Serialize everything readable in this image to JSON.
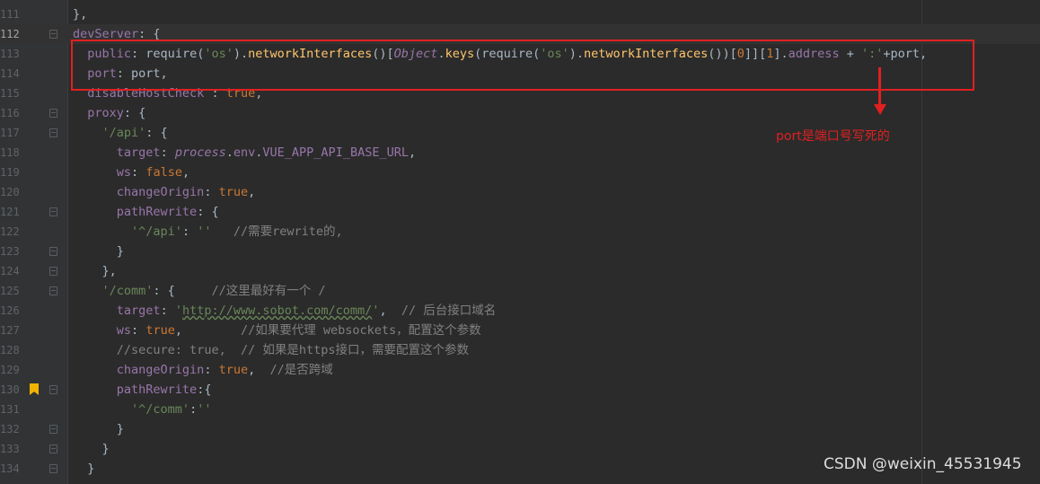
{
  "editor": {
    "lines": [
      {
        "num": "111",
        "html": "},"
      },
      {
        "num": "112",
        "html": "<span class=\"p\">devServer</span>: {"
      },
      {
        "num": "113",
        "html": "  <span class=\"p\">public</span>: require(<span class=\"s\">'os'</span>).<span class=\"f\">networkInterfaces</span>()[<span class=\"p i\">Object</span>.<span class=\"f\">keys</span>(require(<span class=\"s\">'os'</span>).<span class=\"f\">networkInterfaces</span>())[<span class=\"k\">0</span>]][<span class=\"k\">1</span>].<span class=\"p\">address</span> + <span class=\"s\">':'</span>+port,"
      },
      {
        "num": "114",
        "html": "  <span class=\"p\">port</span>: port,"
      },
      {
        "num": "115",
        "html": "  <span class=\"p\">disableHostCheck</span> : <span class=\"k\">true</span>,"
      },
      {
        "num": "116",
        "html": "  <span class=\"p\">proxy</span>: {"
      },
      {
        "num": "117",
        "html": "    <span class=\"s\">'/api'</span>: {"
      },
      {
        "num": "118",
        "html": "      <span class=\"p\">target</span>: <span class=\"p i\">process</span>.<span class=\"p\">env</span>.<span class=\"p\">VUE_APP_API_BASE_URL</span>,"
      },
      {
        "num": "119",
        "html": "      <span class=\"p\">ws</span>: <span class=\"k\">false</span>,"
      },
      {
        "num": "120",
        "html": "      <span class=\"p\">changeOrigin</span>: <span class=\"k\">true</span>,"
      },
      {
        "num": "121",
        "html": "      <span class=\"p\">pathRewrite</span>: {"
      },
      {
        "num": "122",
        "html": "        <span class=\"s\">'^/api'</span>: <span class=\"s\">''</span>   <span class=\"c\">//需要rewrite的,</span>"
      },
      {
        "num": "123",
        "html": "      }"
      },
      {
        "num": "124",
        "html": "    },"
      },
      {
        "num": "125",
        "html": "    <span class=\"s\">'/comm'</span>: {     <span class=\"c\">//这里最好有一个 /</span>"
      },
      {
        "num": "126",
        "html": "      <span class=\"p\">target</span>: <span class=\"s\">'<span class=\"u\">http://www.sobot.com/comm/</span>'</span>,  <span class=\"c\">// 后台接口域名</span>"
      },
      {
        "num": "127",
        "html": "      <span class=\"p\">ws</span>: <span class=\"k\">true</span>,        <span class=\"c\">//如果要代理 websockets，配置这个参数</span>"
      },
      {
        "num": "128",
        "html": "      <span class=\"c\">//secure: true,  // 如果是https接口，需要配置这个参数</span>"
      },
      {
        "num": "129",
        "html": "      <span class=\"p\">changeOrigin</span>: <span class=\"k\">true</span>,  <span class=\"c\">//是否跨域</span>"
      },
      {
        "num": "130",
        "html": "      <span class=\"p\">pathRewrite</span>:{"
      },
      {
        "num": "131",
        "html": "        <span class=\"s\">'^/comm'</span>:<span class=\"s\">''</span>"
      },
      {
        "num": "132",
        "html": "      }"
      },
      {
        "num": "133",
        "html": "    }"
      },
      {
        "num": "134",
        "html": "  }"
      }
    ],
    "current_line": "112",
    "bookmark_line": "130"
  },
  "annotation": {
    "note": "port是端口号写死的",
    "color": "#e02020"
  },
  "watermark": "CSDN @weixin_45531945"
}
